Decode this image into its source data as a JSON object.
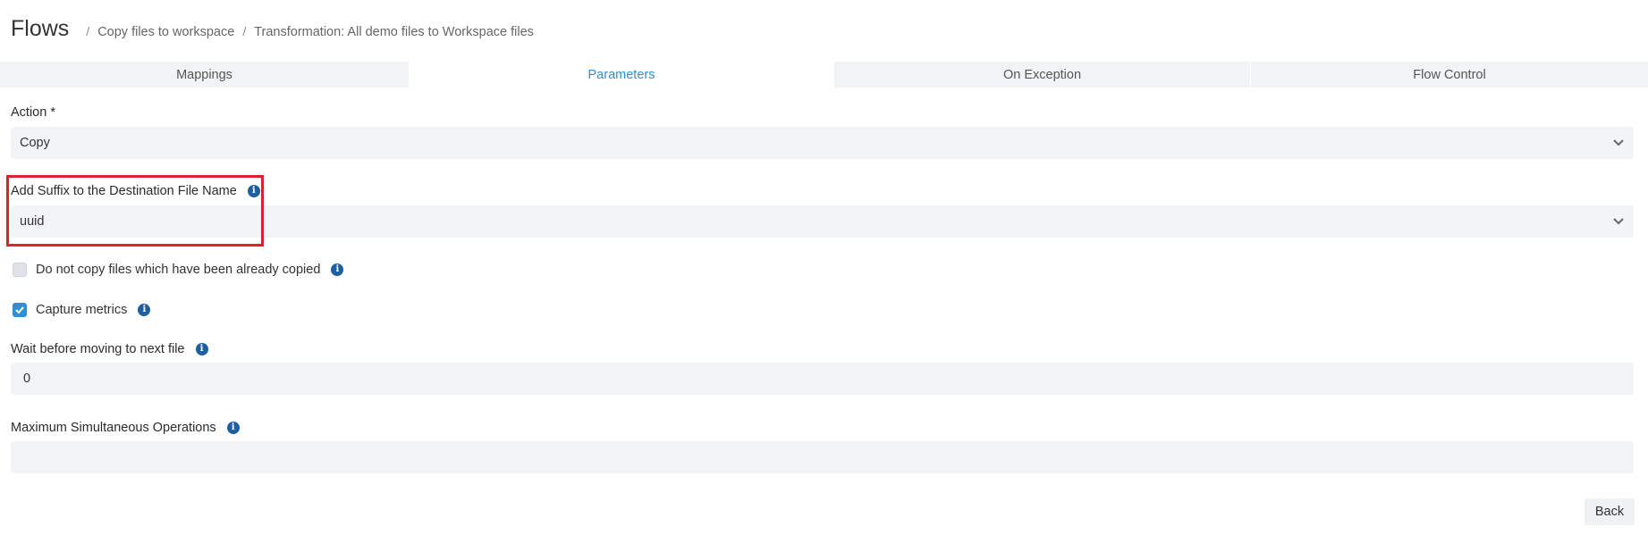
{
  "header": {
    "title": "Flows",
    "breadcrumb": [
      "Copy files to workspace",
      "Transformation: All demo files to Workspace files"
    ],
    "separator": "/"
  },
  "tabs": [
    {
      "label": "Mappings",
      "active": false
    },
    {
      "label": "Parameters",
      "active": true
    },
    {
      "label": "On Exception",
      "active": false
    },
    {
      "label": "Flow Control",
      "active": false
    }
  ],
  "form": {
    "action": {
      "label": "Action *",
      "value": "Copy"
    },
    "suffix": {
      "label": "Add Suffix to the Destination File Name",
      "value": "uuid"
    },
    "skip_copied": {
      "label": "Do not copy files which have been already copied",
      "checked": false
    },
    "capture_metrics": {
      "label": "Capture metrics",
      "checked": true
    },
    "wait": {
      "label": "Wait before moving to next file",
      "value": "0"
    },
    "max_ops": {
      "label": "Maximum Simultaneous Operations",
      "value": ""
    }
  },
  "buttons": {
    "back": "Back"
  },
  "colors": {
    "accent": "#2f8fd6",
    "highlight": "#e0202a",
    "info": "#1d5fa0",
    "field_bg": "#f3f4f6"
  },
  "icons": {
    "info": "info-icon",
    "dropdown": "chevron-down-icon",
    "check": "checkmark-icon"
  }
}
